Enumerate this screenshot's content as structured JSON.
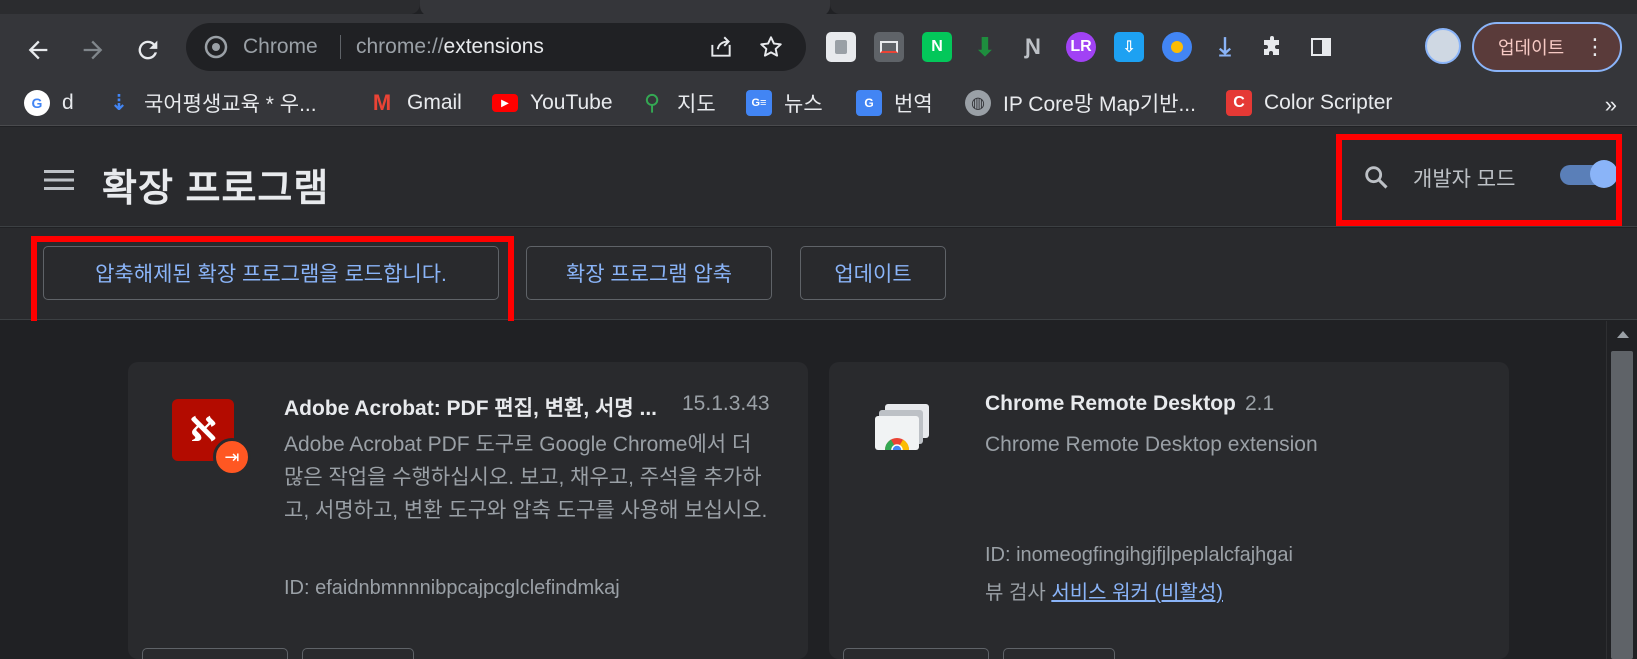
{
  "browser": {
    "omnibox": {
      "chip": "Chrome",
      "url_scheme": "chrome://",
      "url_path": "extensions"
    },
    "profile_button_label": "업데이트",
    "bookmarks": [
      {
        "label": "d",
        "icon": "google-icon"
      },
      {
        "label": "국어평생교육 * 우...",
        "icon": "arrow-icon"
      },
      {
        "label": "Gmail",
        "icon": "gmail-icon"
      },
      {
        "label": "YouTube",
        "icon": "youtube-icon"
      },
      {
        "label": "지도",
        "icon": "maps-icon"
      },
      {
        "label": "뉴스",
        "icon": "news-icon"
      },
      {
        "label": "번역",
        "icon": "translate-icon"
      },
      {
        "label": "IP Core망 Map기반...",
        "icon": "globe-icon"
      },
      {
        "label": "Color Scripter",
        "icon": "color-scripter-icon"
      }
    ],
    "bookmarks_overflow": "»"
  },
  "header": {
    "title": "확장 프로그램",
    "dev_mode_label": "개발자 모드",
    "dev_mode_on": true
  },
  "actions": {
    "load_unpacked": "압축해제된 확장 프로그램을 로드합니다.",
    "pack": "확장 프로그램 압축",
    "update": "업데이트"
  },
  "extensions": [
    {
      "name": "Adobe Acrobat: PDF 편집, 변환, 서명 ...",
      "version": "15.1.3.43",
      "description": "Adobe Acrobat PDF 도구로 Google Chrome에서 더 많은 작업을 수행하십시오. 보고, 채우고, 주석을 추가하고, 서명하고, 변환 도구와 압축 도구를 사용해 보십시오.",
      "id": "ID: efaidnbmnnnibpcajpcglclefindmkaj"
    },
    {
      "name": "Chrome Remote Desktop",
      "version": "2.1",
      "description": "Chrome Remote Desktop extension",
      "id": "ID: inomeogfingihgjfjlpeplalcfajhgai",
      "inspect_prefix": "뷰 검사",
      "inspect_link": "서비스 워커 (비활성)"
    }
  ],
  "colors": {
    "accent": "#8ab4f8",
    "highlight": "#ff0000",
    "background": "#202124",
    "card": "#292a2d"
  }
}
